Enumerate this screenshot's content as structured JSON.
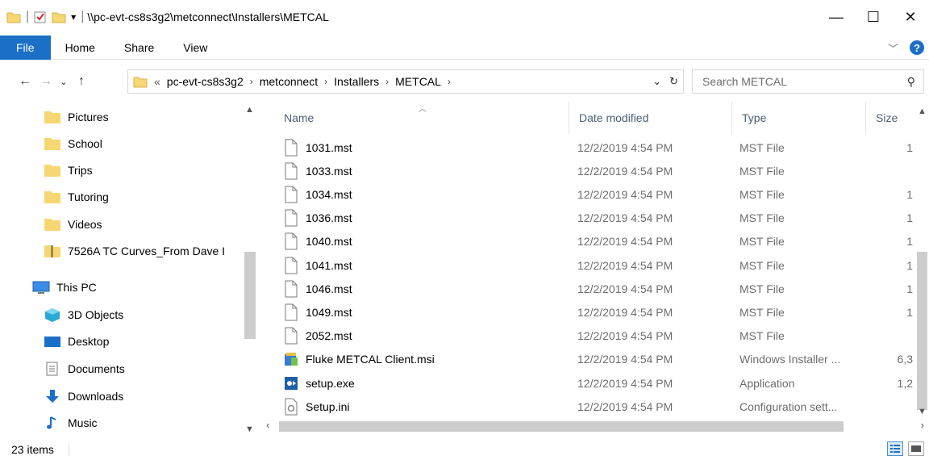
{
  "window": {
    "title_path": "\\\\pc-evt-cs8s3g2\\metconnect\\Installers\\METCAL",
    "minimize": "—",
    "maximize": "☐",
    "close": "✕"
  },
  "ribbon": {
    "tabs": [
      "File",
      "Home",
      "Share",
      "View"
    ]
  },
  "address": {
    "overflow": "«",
    "crumbs": [
      "pc-evt-cs8s3g2",
      "metconnect",
      "Installers",
      "METCAL"
    ]
  },
  "search": {
    "placeholder": "Search METCAL"
  },
  "nav": {
    "items": [
      {
        "label": "Pictures",
        "icon": "folder-icon"
      },
      {
        "label": "School",
        "icon": "folder-icon"
      },
      {
        "label": "Trips",
        "icon": "folder-icon"
      },
      {
        "label": "Tutoring",
        "icon": "folder-icon"
      },
      {
        "label": "Videos",
        "icon": "folder-icon"
      },
      {
        "label": "7526A TC Curves_From Dave I",
        "icon": "zip-folder-icon"
      },
      {
        "label": "This PC",
        "icon": "computer-icon"
      },
      {
        "label": "3D Objects",
        "icon": "cube-icon"
      },
      {
        "label": "Desktop",
        "icon": "desktop-icon"
      },
      {
        "label": "Documents",
        "icon": "documents-icon"
      },
      {
        "label": "Downloads",
        "icon": "download-arrow-icon"
      },
      {
        "label": "Music",
        "icon": "music-note-icon"
      }
    ]
  },
  "columns": {
    "name": "Name",
    "date": "Date modified",
    "type": "Type",
    "size": "Size"
  },
  "files": [
    {
      "name": "1031.mst",
      "date": "12/2/2019 4:54 PM",
      "type": "MST File",
      "size": "1",
      "icon": "blank-file-icon"
    },
    {
      "name": "1033.mst",
      "date": "12/2/2019 4:54 PM",
      "type": "MST File",
      "size": "",
      "icon": "blank-file-icon"
    },
    {
      "name": "1034.mst",
      "date": "12/2/2019 4:54 PM",
      "type": "MST File",
      "size": "1",
      "icon": "blank-file-icon"
    },
    {
      "name": "1036.mst",
      "date": "12/2/2019 4:54 PM",
      "type": "MST File",
      "size": "1",
      "icon": "blank-file-icon"
    },
    {
      "name": "1040.mst",
      "date": "12/2/2019 4:54 PM",
      "type": "MST File",
      "size": "1",
      "icon": "blank-file-icon"
    },
    {
      "name": "1041.mst",
      "date": "12/2/2019 4:54 PM",
      "type": "MST File",
      "size": "1",
      "icon": "blank-file-icon"
    },
    {
      "name": "1046.mst",
      "date": "12/2/2019 4:54 PM",
      "type": "MST File",
      "size": "1",
      "icon": "blank-file-icon"
    },
    {
      "name": "1049.mst",
      "date": "12/2/2019 4:54 PM",
      "type": "MST File",
      "size": "1",
      "icon": "blank-file-icon"
    },
    {
      "name": "2052.mst",
      "date": "12/2/2019 4:54 PM",
      "type": "MST File",
      "size": "",
      "icon": "blank-file-icon"
    },
    {
      "name": "Fluke METCAL Client.msi",
      "date": "12/2/2019 4:54 PM",
      "type": "Windows Installer ...",
      "size": "6,3",
      "icon": "installer-icon"
    },
    {
      "name": "setup.exe",
      "date": "12/2/2019 4:54 PM",
      "type": "Application",
      "size": "1,2",
      "icon": "setup-exe-icon"
    },
    {
      "name": "Setup.ini",
      "date": "12/2/2019 4:54 PM",
      "type": "Configuration sett...",
      "size": "",
      "icon": "settings-file-icon"
    }
  ],
  "status": {
    "count": "23 items"
  },
  "colors": {
    "accent": "#1a6fc7",
    "folder": "#f7d774",
    "header_text": "#4c607a",
    "meta_text": "#6d6d6d"
  }
}
